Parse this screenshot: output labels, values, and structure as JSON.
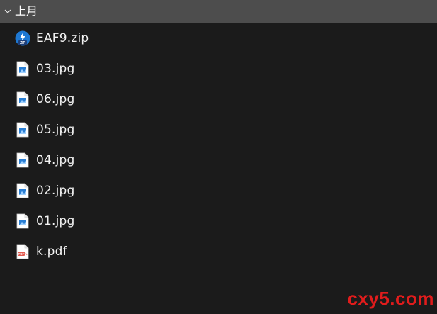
{
  "group": {
    "title": "上月",
    "icon": "chevron-down-icon"
  },
  "files": [
    {
      "name": "EAF9.zip",
      "type": "zip",
      "icon": "zip-archive-icon"
    },
    {
      "name": "03.jpg",
      "type": "jpg",
      "icon": "image-file-icon"
    },
    {
      "name": "06.jpg",
      "type": "jpg",
      "icon": "image-file-icon"
    },
    {
      "name": "05.jpg",
      "type": "jpg",
      "icon": "image-file-icon"
    },
    {
      "name": "04.jpg",
      "type": "jpg",
      "icon": "image-file-icon"
    },
    {
      "name": "02.jpg",
      "type": "jpg",
      "icon": "image-file-icon"
    },
    {
      "name": "01.jpg",
      "type": "jpg",
      "icon": "image-file-icon"
    },
    {
      "name": "k.pdf",
      "type": "pdf",
      "icon": "pdf-file-icon"
    }
  ],
  "watermark": "cxy5.com",
  "colors": {
    "background": "#1b1b1b",
    "header_bg": "#4d4d4d",
    "text": "#f2f2f2",
    "watermark": "#e11c1c",
    "zip_icon": "#1e78d2",
    "pdf_badge": "#e35a4f"
  }
}
